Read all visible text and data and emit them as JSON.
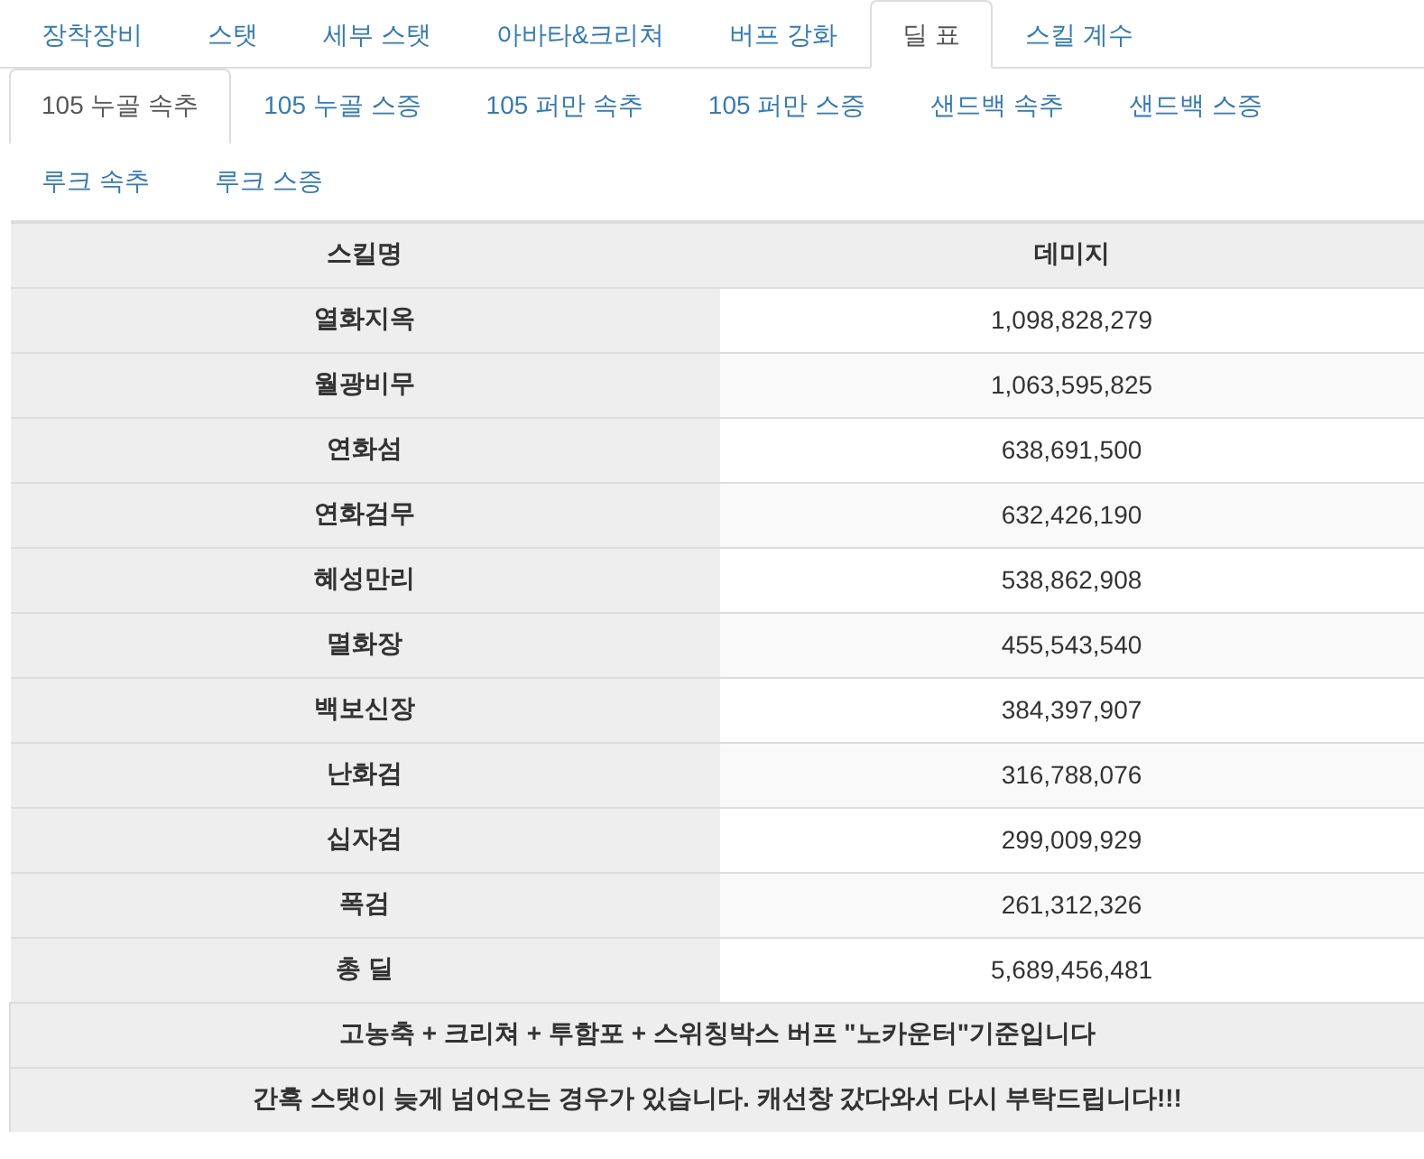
{
  "main_tabs": [
    {
      "label": "장착장비",
      "selected": false
    },
    {
      "label": "스탯",
      "selected": false
    },
    {
      "label": "세부 스탯",
      "selected": false
    },
    {
      "label": "아바타&크리쳐",
      "selected": false
    },
    {
      "label": "버프 강화",
      "selected": false
    },
    {
      "label": "딜 표",
      "selected": true
    },
    {
      "label": "스킬 계수",
      "selected": false
    }
  ],
  "sub_tabs": [
    {
      "label": "105 누골 속추",
      "selected": true
    },
    {
      "label": "105 누골 스증",
      "selected": false
    },
    {
      "label": "105 퍼만 속추",
      "selected": false
    },
    {
      "label": "105 퍼만 스증",
      "selected": false
    },
    {
      "label": "샌드백 속추",
      "selected": false
    },
    {
      "label": "샌드백 스증",
      "selected": false
    },
    {
      "label": "루크 속추",
      "selected": false
    },
    {
      "label": "루크 스증",
      "selected": false
    }
  ],
  "table": {
    "columns": [
      "스킬명",
      "데미지"
    ],
    "rows": [
      [
        "열화지옥",
        "1,098,828,279"
      ],
      [
        "월광비무",
        "1,063,595,825"
      ],
      [
        "연화섬",
        "638,691,500"
      ],
      [
        "연화검무",
        "632,426,190"
      ],
      [
        "혜성만리",
        "538,862,908"
      ],
      [
        "멸화장",
        "455,543,540"
      ],
      [
        "백보신장",
        "384,397,907"
      ],
      [
        "난화검",
        "316,788,076"
      ],
      [
        "십자검",
        "299,009,929"
      ],
      [
        "폭검",
        "261,312,326"
      ],
      [
        "총 딜",
        "5,689,456,481"
      ]
    ],
    "notes": [
      "고농축 + 크리쳐 + 투함포 + 스위칭박스 버프 \"노카운터\"기준입니다",
      "간혹 스탯이 늦게 넘어오는 경우가 있습니다. 캐선창 갔다와서 다시 부탁드립니다!!!"
    ]
  }
}
